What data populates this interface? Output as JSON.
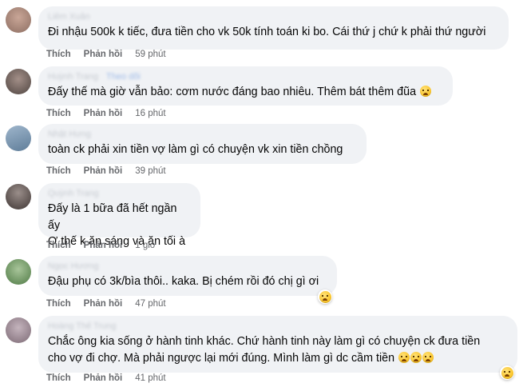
{
  "labels": {
    "like": "Thích",
    "reply": "Phản hồi"
  },
  "comments": [
    {
      "author": "Liêm Xuân",
      "text": "Đi nhậu 500k k tiếc, đưa tiền cho vk 50k tính toán ki bo. Cái thứ j chứ k phải thứ người",
      "time": "59 phút",
      "avatar_color": "#b89485"
    },
    {
      "author": "Huỳnh Trang",
      "tag": "Theo dõi",
      "text": "Đấy thế mà giờ vẫn bảo: cơm nước đáng bao nhiêu. Thêm bát thêm đũa",
      "emoji": [
        "crying-face"
      ],
      "time": "16 phút",
      "avatar_color": "#7b6a64"
    },
    {
      "author": "Nhật Hưng",
      "text": "toàn ck phải xin tiền vợ làm gì có chuyện vk xin tiền chồng",
      "time": "39 phút",
      "avatar_color": "#7d9ab4"
    },
    {
      "author": "Quỳnh Trang",
      "text": "Đấy là 1 bữa đã hết ngần ấy\nƠ thế k ăn sáng và ăn tối à",
      "time": "1 giờ",
      "avatar_color": "#6a5f5c"
    },
    {
      "author": "Ngọc Hương",
      "text": "Đậu phụ có 3k/bìa thôi.. kaka. Bị chém rồi đó chị gì ơi",
      "time": "47 phút",
      "reaction": "laughing-face",
      "avatar_color": "#6f9a62"
    },
    {
      "author": "Hoàng Thế Trung",
      "text": "Chắc ông kia sống ở hành tinh khác. Chứ hành tinh này làm gì có chuyện ck đưa tiền\ncho vợ đi chợ. Mà phải ngược lại mới đúng. Mình làm gì dc cầm tiền",
      "emoji": [
        "crying-face",
        "crying-face",
        "crying-face"
      ],
      "time": "41 phút",
      "reaction": "sad-face",
      "avatar_color": "#9a8893"
    }
  ]
}
